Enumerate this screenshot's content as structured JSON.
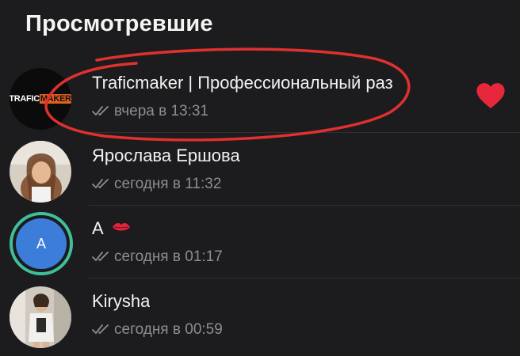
{
  "header": {
    "title": "Просмотревшие"
  },
  "viewers": [
    {
      "name": "Traficmaker | Профессиональный раз",
      "status": "вчера в 13:31",
      "avatar": "logo",
      "logo_text_a": "TRAFIC",
      "logo_text_b": "MAKER",
      "reaction": "heart-icon"
    },
    {
      "name": "Ярослава Ершова",
      "status": "сегодня в 11:32",
      "avatar": "photo-woman"
    },
    {
      "name": "А",
      "status": "сегодня в 01:17",
      "avatar": "letter",
      "avatar_letter": "A",
      "name_emoji": "lips-icon"
    },
    {
      "name": "Kirysha",
      "status": "сегодня в 00:59",
      "avatar": "photo-mirror"
    }
  ],
  "colors": {
    "background": "#1c1c1e",
    "heart": "#e8283a",
    "annotation": "#e0302f",
    "story_ring": "#3fbf9b",
    "avatar_blue": "#3b7dd8"
  }
}
